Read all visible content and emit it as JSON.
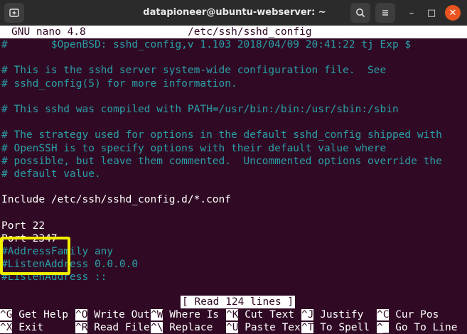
{
  "window": {
    "title": "datapioneer@ubuntu-webserver: ~",
    "new_tab_icon": "new-tab-icon",
    "search_icon": "search-icon",
    "menu_icon": "hamburger-menu-icon",
    "minimize_glyph": "–",
    "maximize_glyph": "□",
    "close_glyph": "✕",
    "close_color": "#e95420"
  },
  "nano": {
    "version": "GNU nano 4.8",
    "filename": "/etc/ssh/sshd_config",
    "status_message": "[ Read 124 lines ]"
  },
  "file_lines": [
    {
      "text": "#       $OpenBSD: sshd_config,v 1.103 2018/04/09 20:41:22 tj Exp $",
      "type": "comment"
    },
    {
      "text": "",
      "type": "blank"
    },
    {
      "text": "# This is the sshd server system-wide configuration file.  See",
      "type": "comment"
    },
    {
      "text": "# sshd_config(5) for more information.",
      "type": "comment"
    },
    {
      "text": "",
      "type": "blank"
    },
    {
      "text": "# This sshd was compiled with PATH=/usr/bin:/bin:/usr/sbin:/sbin",
      "type": "comment"
    },
    {
      "text": "",
      "type": "blank"
    },
    {
      "text": "# The strategy used for options in the default sshd_config shipped with",
      "type": "comment"
    },
    {
      "text": "# OpenSSH is to specify options with their default value where",
      "type": "comment"
    },
    {
      "text": "# possible, but leave them commented.  Uncommented options override the",
      "type": "comment"
    },
    {
      "text": "# default value.",
      "type": "comment"
    },
    {
      "text": "",
      "type": "blank"
    },
    {
      "text": "Include /etc/ssh/sshd_config.d/*.conf",
      "type": "directive"
    },
    {
      "text": "",
      "type": "blank"
    },
    {
      "text": "Port 22",
      "type": "directive"
    },
    {
      "text": "Port 2347",
      "type": "directive"
    },
    {
      "text": "#AddressFamily any",
      "type": "comment"
    },
    {
      "text": "#ListenAddress 0.0.0.0",
      "type": "comment"
    },
    {
      "text": "#ListenAddress ::",
      "type": "comment"
    }
  ],
  "shortcuts": [
    [
      {
        "key": "^G",
        "label": " Get Help"
      },
      {
        "key": "^O",
        "label": " Write Out"
      },
      {
        "key": "^W",
        "label": " Where Is"
      },
      {
        "key": "^K",
        "label": " Cut Text"
      },
      {
        "key": "^J",
        "label": " Justify"
      },
      {
        "key": "^C",
        "label": " Cur Pos"
      }
    ],
    [
      {
        "key": "^X",
        "label": " Exit"
      },
      {
        "key": "^R",
        "label": " Read File"
      },
      {
        "key": "^\\",
        "label": " Replace"
      },
      {
        "key": "^U",
        "label": " Paste Text"
      },
      {
        "key": "^T",
        "label": " To Spell"
      },
      {
        "key": "^_",
        "label": " Go To Line"
      }
    ]
  ],
  "colors": {
    "background": "#300a24",
    "comment": "#2a9fa8",
    "text": "#ffffff",
    "highlight_box": "#f5ef00"
  }
}
